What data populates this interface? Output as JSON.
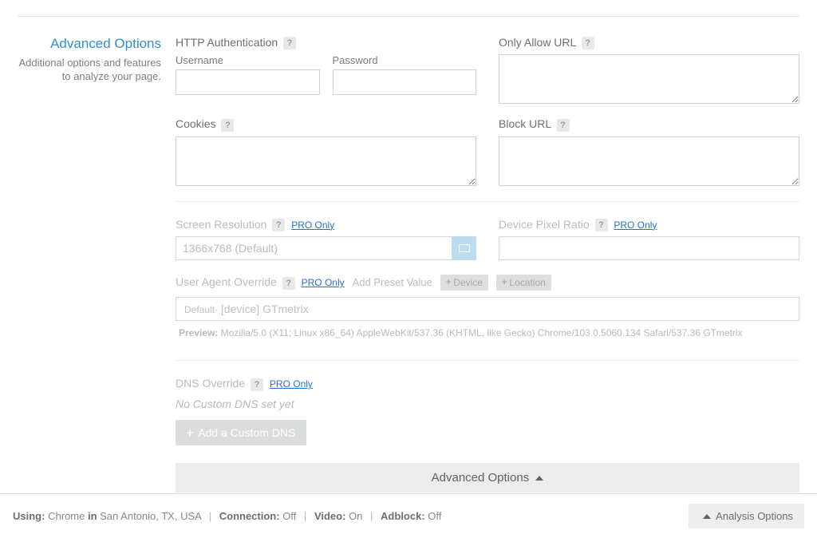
{
  "side": {
    "title": "Advanced Options",
    "desc": "Additional options and features to analyze your page."
  },
  "labels": {
    "http_auth": "HTTP Authentication",
    "username": "Username",
    "password": "Password",
    "cookies": "Cookies",
    "only_allow": "Only Allow URL",
    "block_url": "Block URL",
    "screen_res": "Screen Resolution",
    "dpr": "Device Pixel Ratio",
    "ua_override": "User Agent Override",
    "add_preset": "Add Preset Value",
    "btn_device": "Device",
    "btn_location": "Location",
    "dns_override": "DNS Override",
    "pro_only": "PRO Only",
    "help_glyph": "?"
  },
  "values": {
    "screen_res_default": "1366x768 (Default)",
    "ua_prefix": "Default",
    "ua_device_token": "[device]",
    "ua_suffix": "GTmetrix",
    "preview_label": "Preview:",
    "preview_text": "Mozilla/5.0 (X11; Linux x86_64) AppleWebKit/537.36 (KHTML, like Gecko) Chrome/103.0.5060.134 Safari/537.36 GTmetrix",
    "dns_none": "No Custom DNS set yet",
    "add_dns": "Add a Custom DNS",
    "adv_toggle": "Advanced Options"
  },
  "footer": {
    "using": "Using:",
    "browser": "Chrome",
    "in": "in",
    "location": "San Antonio, TX, USA",
    "connection_label": "Connection:",
    "connection_val": "Off",
    "video_label": "Video:",
    "video_val": "On",
    "adblock_label": "Adblock:",
    "adblock_val": "Off",
    "analysis_btn": "Analysis Options"
  }
}
